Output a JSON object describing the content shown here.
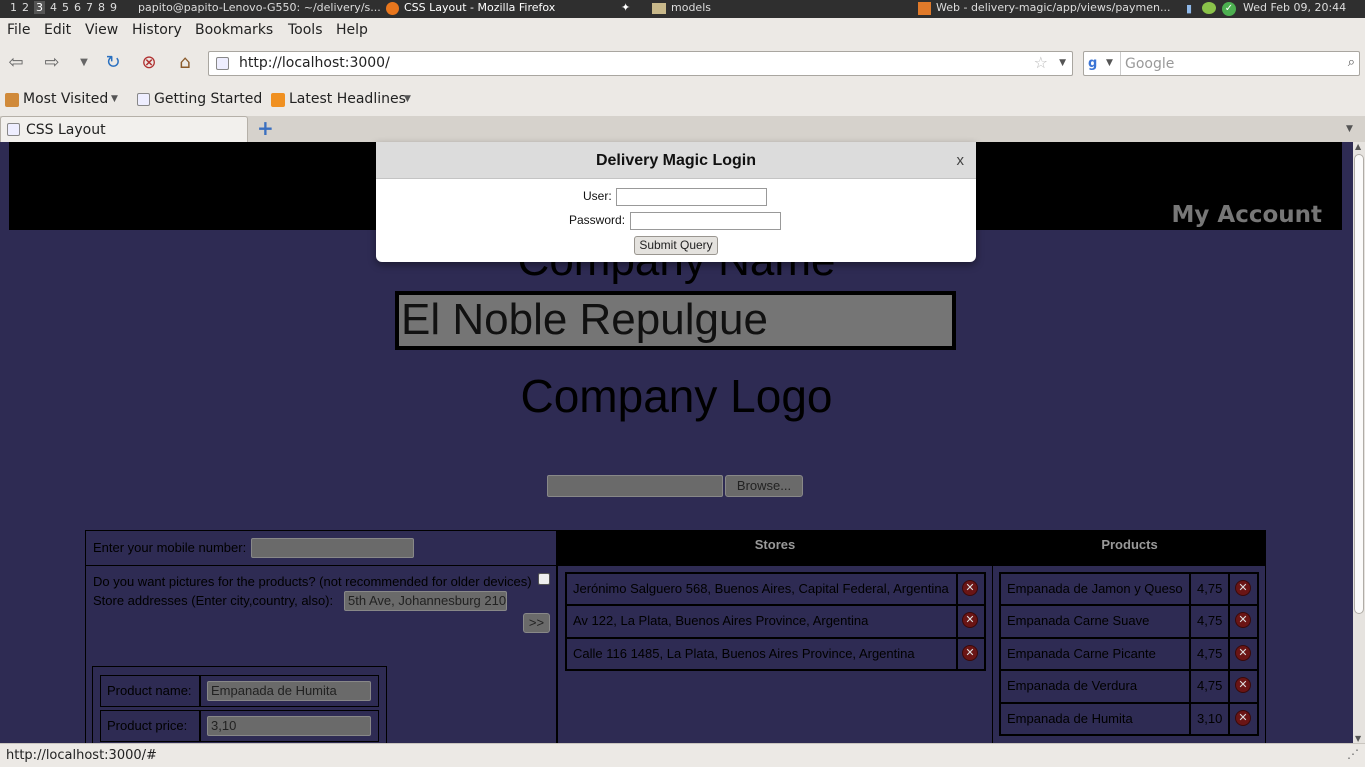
{
  "panel": {
    "workspaces": [
      "1",
      "2",
      "3",
      "4",
      "5",
      "6",
      "7",
      "8",
      "9"
    ],
    "terminal_title": "papito@papito-Lenovo-G550: ~/delivery/s...",
    "firefox_title": "CSS Layout - Mozilla Firefox",
    "folder_title": "models",
    "web_title": "Web - delivery-magic/app/views/paymen...",
    "clock": "Wed Feb 09, 20:44"
  },
  "menu": [
    "File",
    "Edit",
    "View",
    "History",
    "Bookmarks",
    "Tools",
    "Help"
  ],
  "nav": {
    "url": "http://localhost:3000/",
    "search_placeholder": "Google"
  },
  "bookmarks": [
    "Most Visited",
    "Getting Started",
    "Latest Headlines"
  ],
  "tabs": [
    {
      "label": "CSS Layout"
    }
  ],
  "page": {
    "my_account": "My Account",
    "company_name_label": "Company Name",
    "company_name_value": "El Noble Repulgue",
    "company_logo_label": "Company Logo",
    "browse_button": "Browse...",
    "mobile_label": "Enter your mobile number:",
    "pictures_question": "Do you want pictures for the products? (not recommended for older devices)",
    "store_addresses_label": "Store addresses (Enter city,country, also):",
    "store_address_value": "5th Ave, Johannesburg 210",
    "add_button": ">>",
    "product_name_label": "Product name:",
    "product_name_value": "Empanada de Humita",
    "product_price_label": "Product price:",
    "product_price_value": "3,10",
    "stores_header": "Stores",
    "products_header": "Products",
    "stores": [
      "Jerónimo Salguero 568, Buenos Aires, Capital Federal, Argentina",
      "Av 122, La Plata, Buenos Aires Province, Argentina",
      "Calle 116 1485, La Plata, Buenos Aires Province, Argentina"
    ],
    "products": [
      {
        "name": "Empanada de Jamon y Queso",
        "price": "4,75"
      },
      {
        "name": "Empanada Carne Suave",
        "price": "4,75"
      },
      {
        "name": "Empanada Carne Picante",
        "price": "4,75"
      },
      {
        "name": "Empanada de Verdura",
        "price": "4,75"
      },
      {
        "name": "Empanada de Humita",
        "price": "3,10"
      }
    ]
  },
  "dialog": {
    "title": "Delivery Magic Login",
    "close": "x",
    "user_label": "User:",
    "password_label": "Password:",
    "submit": "Submit Query"
  },
  "status": "http://localhost:3000/#",
  "colors": {
    "page_bg": "#2e2b53",
    "header_bg": "#000000",
    "input_gray": "#6a6a6a"
  }
}
